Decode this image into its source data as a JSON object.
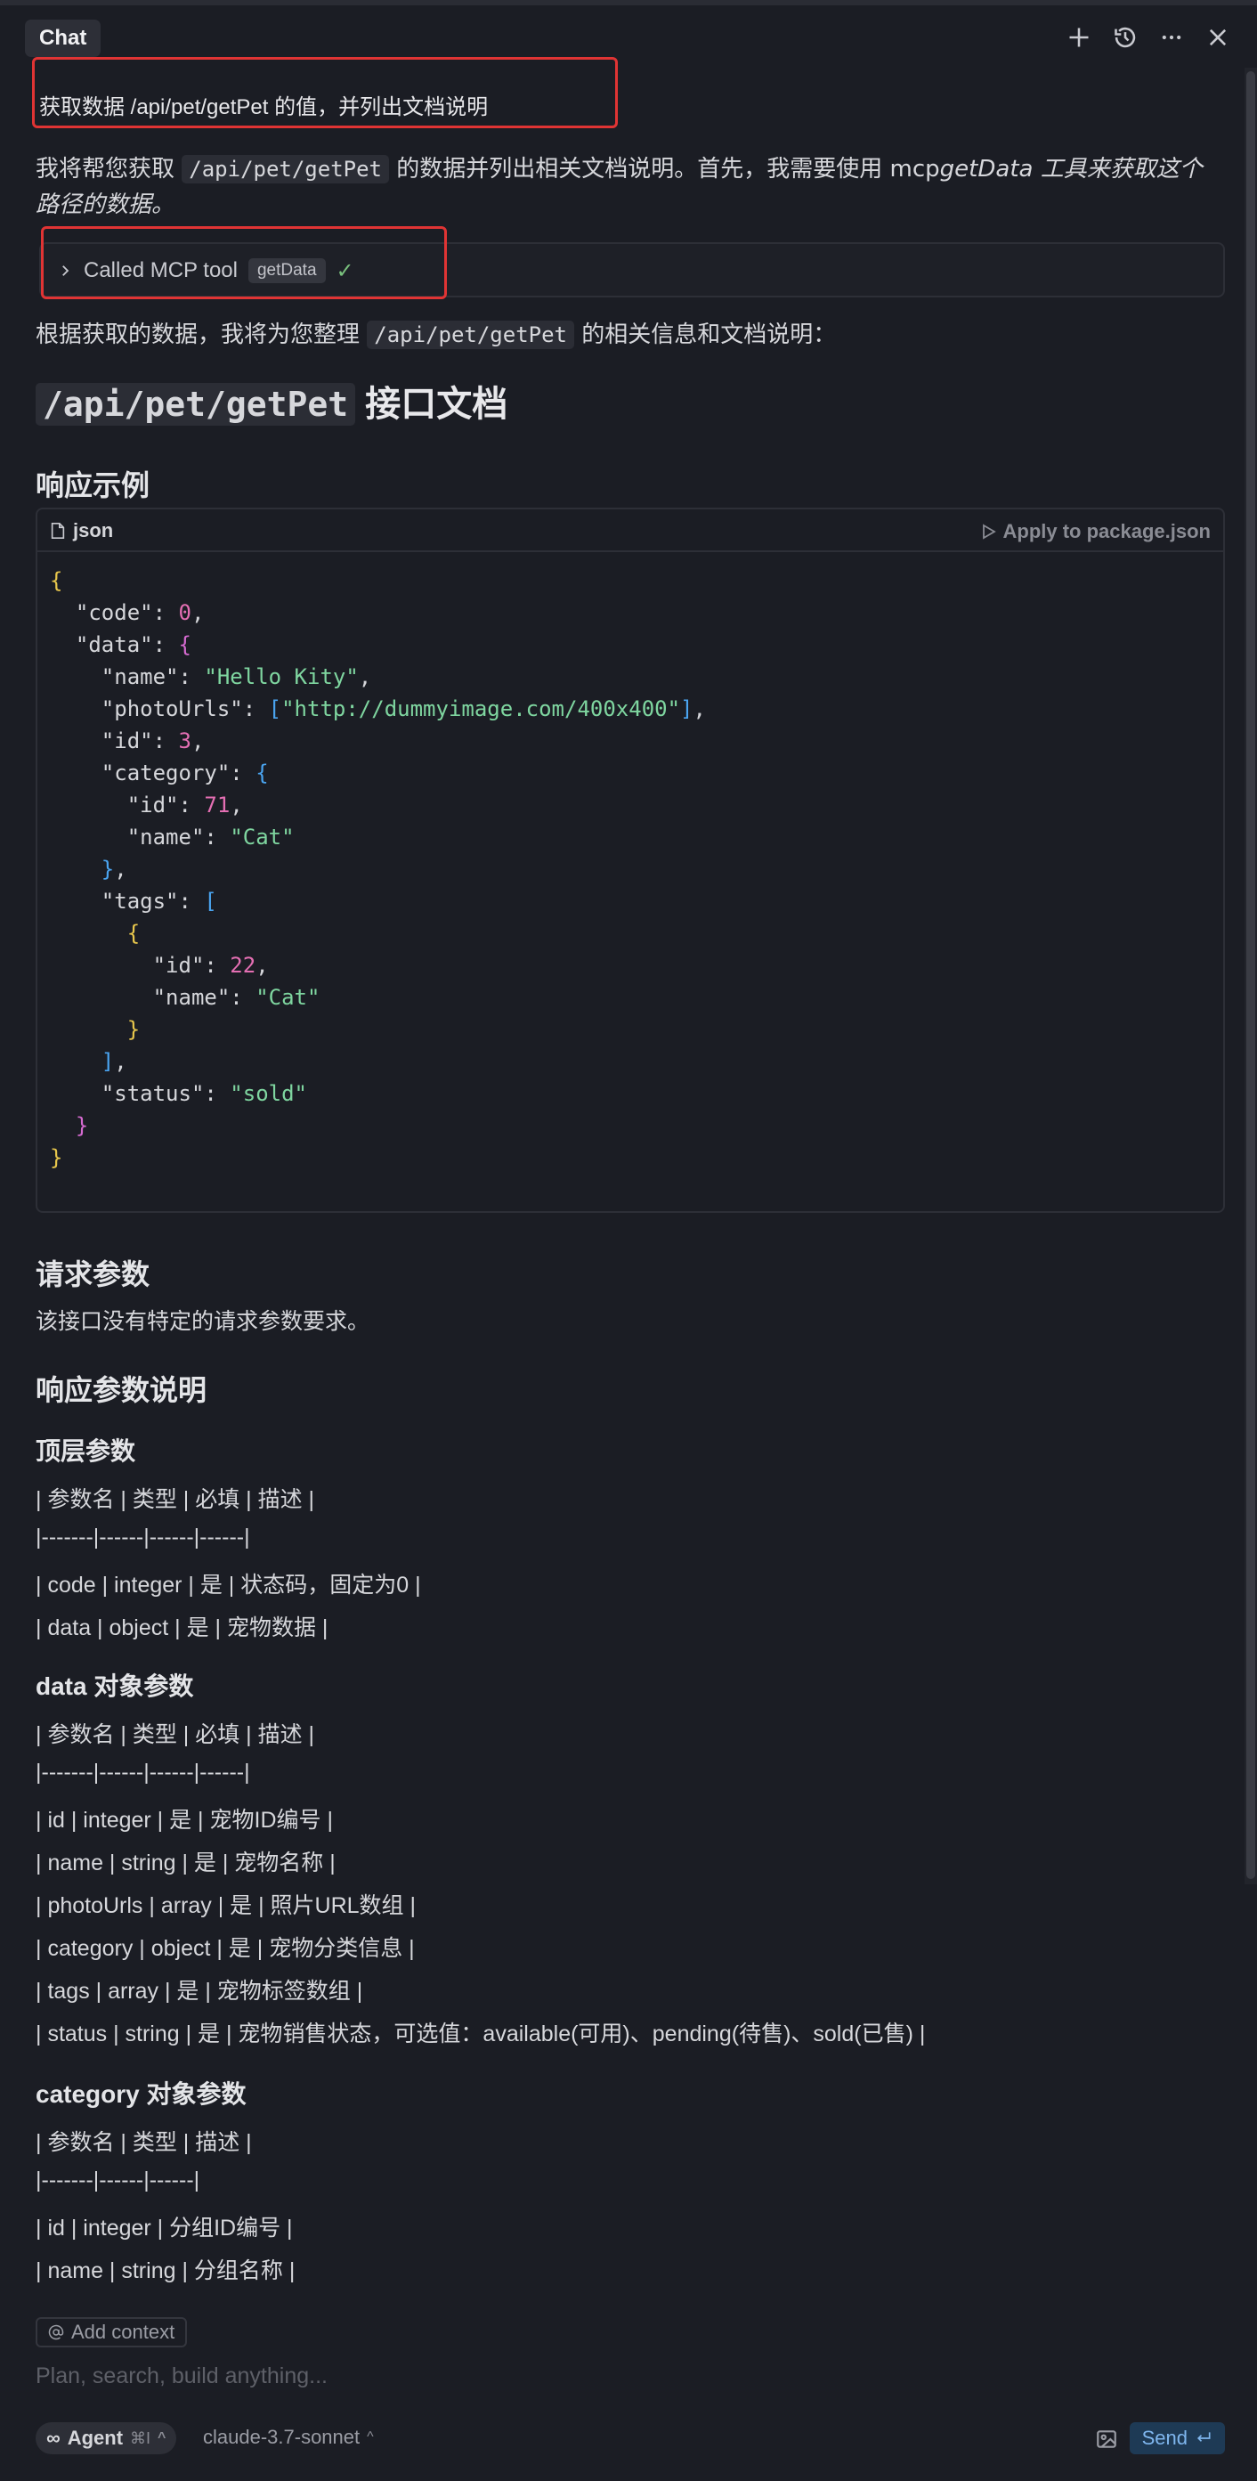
{
  "header": {
    "tab_label": "Chat",
    "icons": [
      "plus-icon",
      "history-icon",
      "more-icon",
      "close-icon"
    ]
  },
  "user_message": "获取数据 /api/pet/getPet 的值，并列出文档说明",
  "assistant_intro": {
    "before": "我将帮您获取 ",
    "code": "/api/pet/getPet",
    "after": " 的数据并列出相关文档说明。首先，我需要使用 mcp",
    "italic": "getData 工具来获取这个路径的数据。"
  },
  "tool_call": {
    "label": "Called MCP tool",
    "tool_name": "getData",
    "status": "✓"
  },
  "summary": {
    "before": "根据获取的数据，我将为您整理 ",
    "code": "/api/pet/getPet",
    "after": " 的相关信息和文档说明："
  },
  "doc_title": {
    "code": "/api/pet/getPet",
    "text": " 接口文档"
  },
  "response_example_heading": "响应示例",
  "code_block": {
    "language": "json",
    "apply_label": "Apply to package.json"
  },
  "request_params_heading": "请求参数",
  "request_params_text": "该接口没有特定的请求参数要求。",
  "response_params_heading": "响应参数说明",
  "top_params": {
    "heading": "顶层参数",
    "lines": [
      "| 参数名 | 类型 | 必填 | 描述 |",
      "|-------|------|------|------|",
      "| code | integer | 是 | 状态码，固定为0 |",
      "| data | object | 是 | 宠物数据 |"
    ]
  },
  "data_params": {
    "heading": "data 对象参数",
    "lines": [
      "| 参数名 | 类型 | 必填 | 描述 |",
      "|-------|------|------|------|",
      "| id | integer | 是 | 宠物ID编号 |",
      "| name | string | 是 | 宠物名称 |",
      "| photoUrls | array | 是 | 照片URL数组 |",
      "| category | object | 是 | 宠物分类信息 |",
      "| tags | array | 是 | 宠物标签数组 |",
      "| status | string | 是 | 宠物销售状态，可选值：available(可用)、pending(待售)、sold(已售) |"
    ]
  },
  "category_params": {
    "heading": "category 对象参数",
    "lines": [
      "| 参数名 | 类型 | 描述 |",
      "|-------|------|------|",
      "| id | integer | 分组ID编号 |",
      "| name | string | 分组名称 |"
    ]
  },
  "composer": {
    "add_context": "Add context",
    "placeholder": "Plan, search, build anything...",
    "agent_label": "Agent",
    "agent_shortcut": "⌘I",
    "model": "claude-3.7-sonnet",
    "send_label": "Send"
  }
}
